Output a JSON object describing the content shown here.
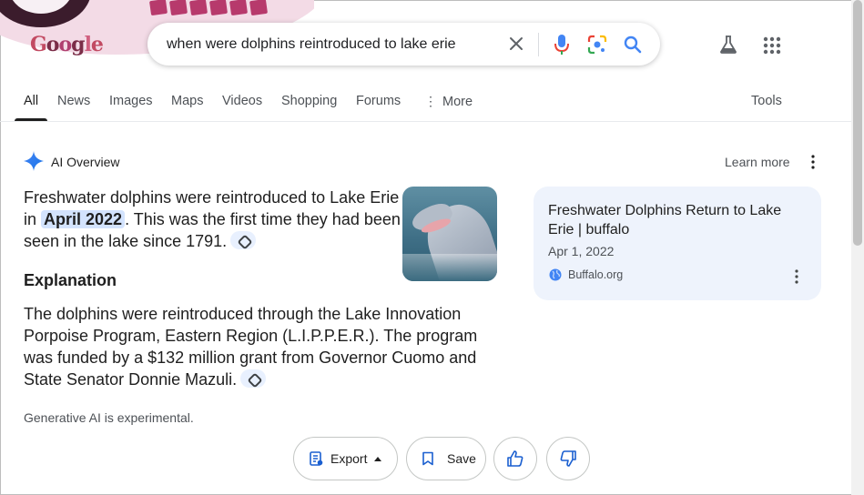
{
  "search": {
    "query": "when were dolphins reintroduced to lake erie"
  },
  "logo": {
    "text": "Google",
    "style": "doodle"
  },
  "tabs": [
    {
      "label": "All",
      "active": true
    },
    {
      "label": "News"
    },
    {
      "label": "Images"
    },
    {
      "label": "Maps"
    },
    {
      "label": "Videos"
    },
    {
      "label": "Shopping"
    },
    {
      "label": "Forums"
    },
    {
      "label": "More"
    }
  ],
  "tools_label": "Tools",
  "ai_overview": {
    "title": "AI Overview",
    "learn_more": "Learn more",
    "para1_a": "Freshwater dolphins were reintroduced to Lake Erie in ",
    "para1_highlight": "April 2022",
    "para1_b": ". This was the first time they had been seen in the lake since 1791.",
    "explanation_heading": "Explanation",
    "para2": "The dolphins were reintroduced through the Lake Innovation Porpoise Program, Eastern Region (L.I.P.P.E.R.). The program was funded by a $132 million grant from Governor Cuomo and State Senator Donnie Mazuli.",
    "generative_note": "Generative AI is experimental."
  },
  "source_card": {
    "title": "Freshwater Dolphins Return to Lake Erie | buffalo",
    "date": "Apr 1, 2022",
    "site": "Buffalo.org"
  },
  "actions": {
    "export_label": "Export",
    "save_label": "Save"
  },
  "colors": {
    "accent_blue": "#1a73e8",
    "highlight": "#d3e3fd",
    "card_bg": "#eef3fc"
  }
}
